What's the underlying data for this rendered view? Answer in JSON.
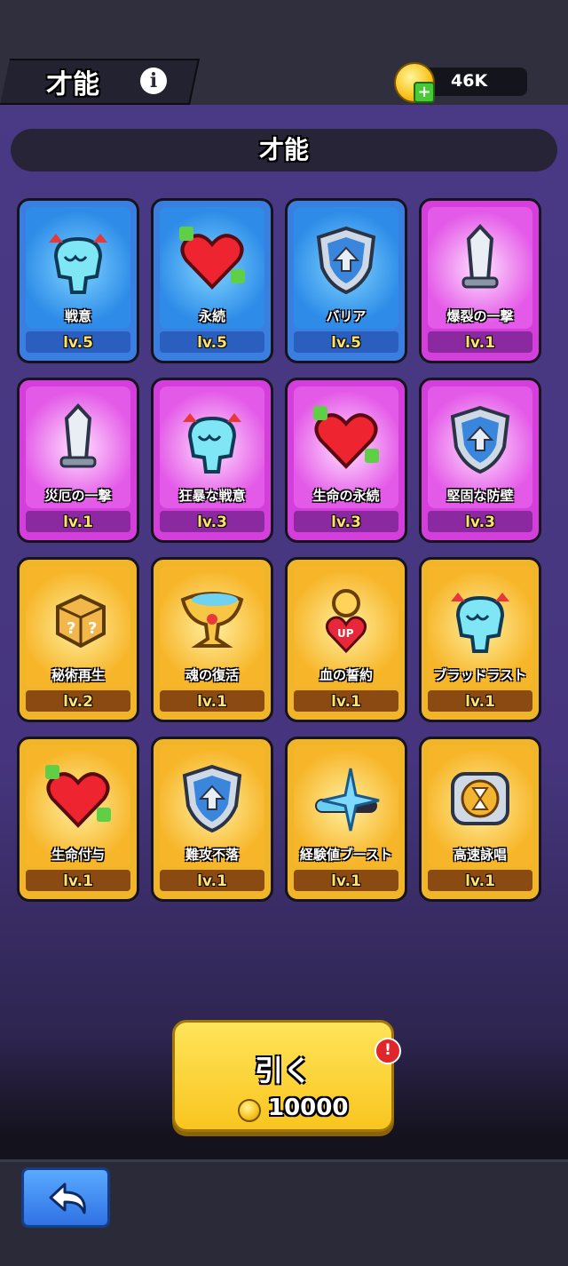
{
  "header": {
    "title": "才能",
    "info_icon": "info-icon",
    "coins": "46K",
    "coin_icon": "coin-plus-icon"
  },
  "section": {
    "title": "才能"
  },
  "cards": [
    {
      "name": "戦意",
      "level": "lv.5",
      "rarity": "blue",
      "icon": "fist-icon"
    },
    {
      "name": "永続",
      "level": "lv.5",
      "rarity": "blue",
      "icon": "heart-icon"
    },
    {
      "name": "バリア",
      "level": "lv.5",
      "rarity": "blue",
      "icon": "shield-icon"
    },
    {
      "name": "爆裂の一撃",
      "level": "lv.1",
      "rarity": "purple",
      "icon": "blade-icon"
    },
    {
      "name": "災厄の一撃",
      "level": "lv.1",
      "rarity": "purple",
      "icon": "blade-icon"
    },
    {
      "name": "狂暴な戦意",
      "level": "lv.3",
      "rarity": "purple",
      "icon": "fist-icon"
    },
    {
      "name": "生命の永続",
      "level": "lv.3",
      "rarity": "purple",
      "icon": "heart-icon"
    },
    {
      "name": "堅固な防壁",
      "level": "lv.3",
      "rarity": "purple",
      "icon": "shield-icon"
    },
    {
      "name": "秘術再生",
      "level": "lv.2",
      "rarity": "gold",
      "icon": "dice-icon"
    },
    {
      "name": "魂の復活",
      "level": "lv.1",
      "rarity": "gold",
      "icon": "chalice-icon"
    },
    {
      "name": "血の誓約",
      "level": "lv.1",
      "rarity": "gold",
      "icon": "heart-up-icon"
    },
    {
      "name": "ブラッドラスト",
      "level": "lv.1",
      "rarity": "gold",
      "icon": "fist-icon"
    },
    {
      "name": "生命付与",
      "level": "lv.1",
      "rarity": "gold",
      "icon": "heart-icon"
    },
    {
      "name": "難攻不落",
      "level": "lv.1",
      "rarity": "gold",
      "icon": "shield-icon"
    },
    {
      "name": "経験値ブースト",
      "level": "lv.1",
      "rarity": "gold",
      "icon": "sparkle-icon"
    },
    {
      "name": "高速詠唱",
      "level": "lv.1",
      "rarity": "gold",
      "icon": "hourglass-icon"
    }
  ],
  "draw_button": {
    "label": "引く",
    "cost": "10000",
    "alert": "!"
  },
  "footer": {
    "back_icon": "back-arrow-icon"
  }
}
